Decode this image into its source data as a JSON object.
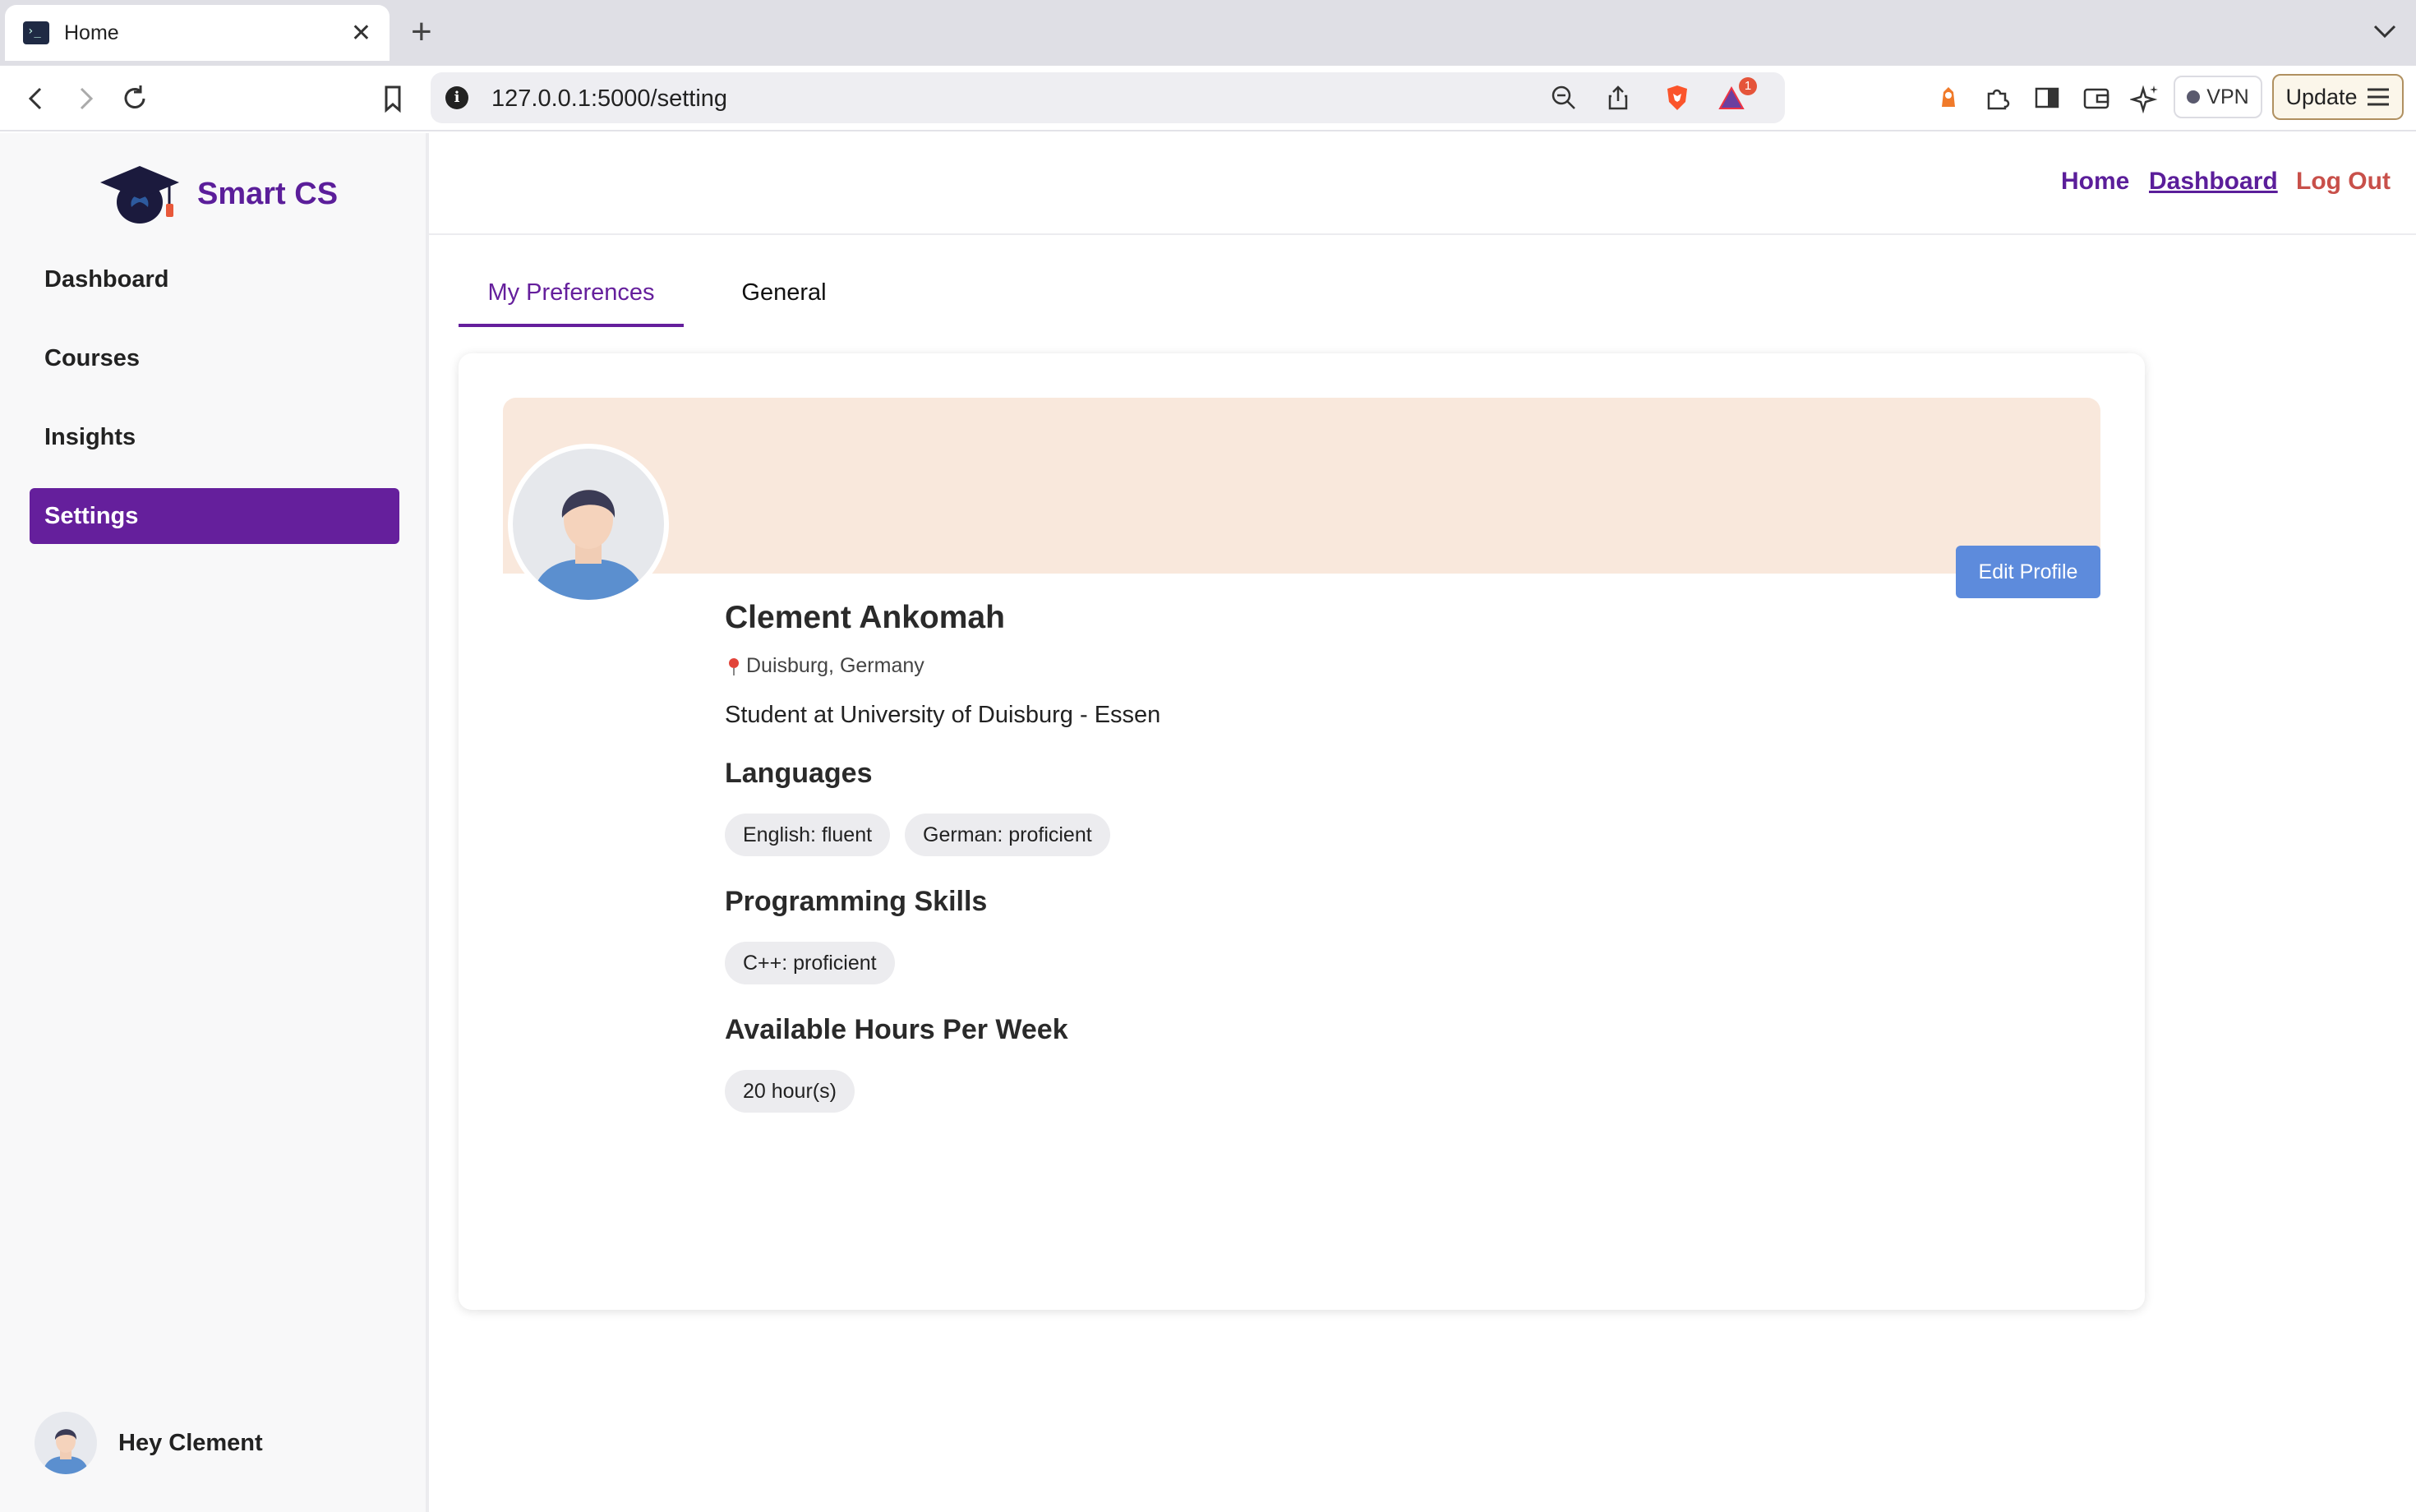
{
  "browser": {
    "tab_title": "Home",
    "url": "127.0.0.1:5000/setting",
    "vpn_label": "VPN",
    "update_label": "Update",
    "rewards_badge": "1"
  },
  "app": {
    "brand_name": "Smart CS",
    "accent_color": "#651f9c",
    "sidebar": {
      "items": [
        {
          "label": "Dashboard"
        },
        {
          "label": "Courses"
        },
        {
          "label": "Insights"
        },
        {
          "label": "Settings",
          "active": true
        }
      ],
      "greeting": "Hey Clement"
    },
    "topnav": {
      "home": "Home",
      "dashboard": "Dashboard",
      "logout": "Log Out"
    },
    "tabs": {
      "preferences": "My Preferences",
      "general": "General"
    },
    "profile": {
      "edit_label": "Edit Profile",
      "name": "Clement Ankomah",
      "location": "Duisburg, Germany",
      "bio": "Student at University of Duisburg - Essen",
      "languages_heading": "Languages",
      "languages": [
        "English: fluent",
        "German: proficient"
      ],
      "skills_heading": "Programming Skills",
      "skills": [
        "C++: proficient"
      ],
      "hours_heading": "Available Hours Per Week",
      "hours": "20 hour(s)"
    }
  }
}
